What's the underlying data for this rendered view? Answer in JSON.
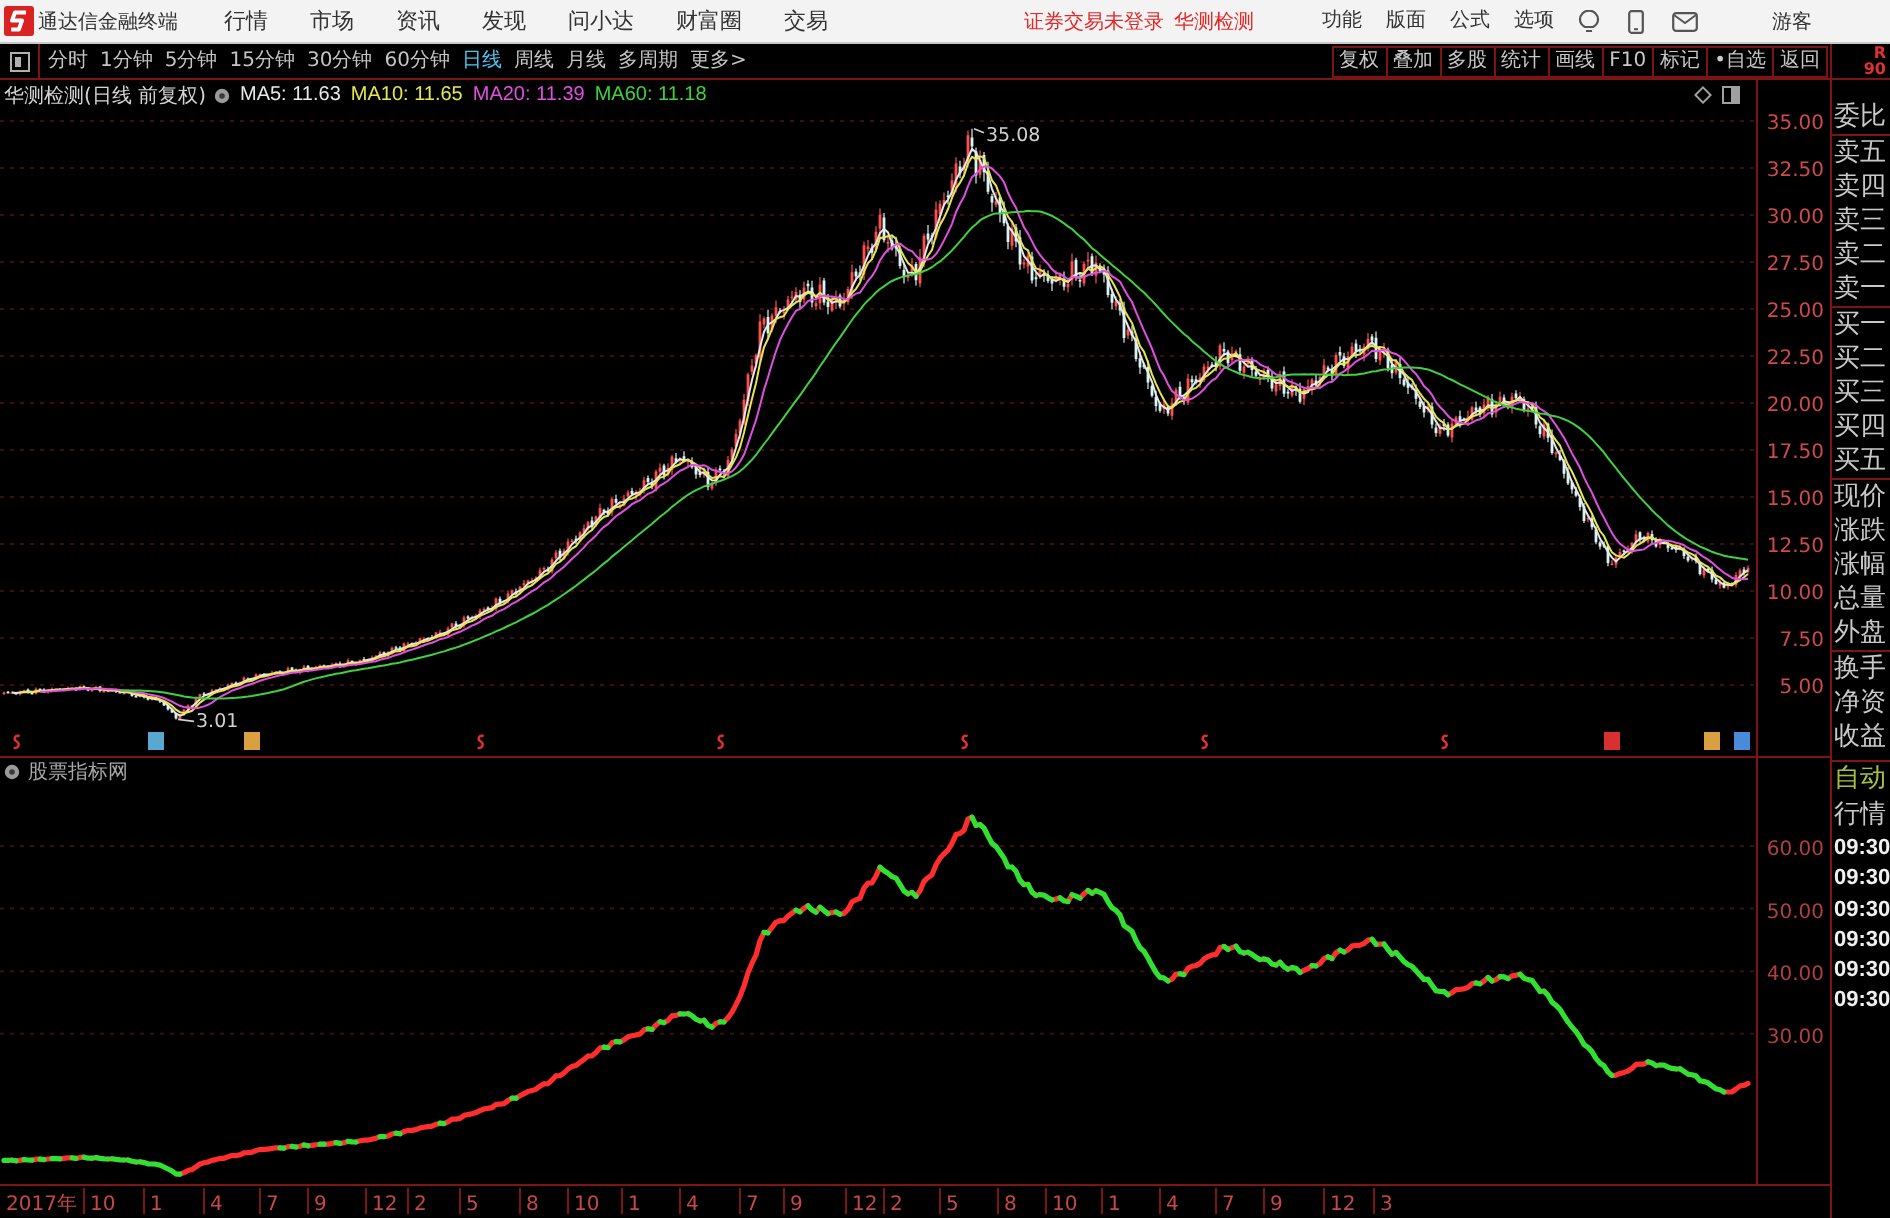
{
  "app": {
    "name": "通达信金融终端"
  },
  "menu": [
    "行情",
    "市场",
    "资讯",
    "发现",
    "问小达",
    "财富圈",
    "交易"
  ],
  "notices": [
    "证券交易未登录",
    "华测检测"
  ],
  "actions": [
    "功能",
    "版面",
    "公式",
    "选项"
  ],
  "user": "游客",
  "periods": [
    {
      "label": "分时",
      "selected": false
    },
    {
      "label": "1分钟",
      "selected": false
    },
    {
      "label": "5分钟",
      "selected": false
    },
    {
      "label": "15分钟",
      "selected": false
    },
    {
      "label": "30分钟",
      "selected": false
    },
    {
      "label": "60分钟",
      "selected": false
    },
    {
      "label": "日线",
      "selected": true
    },
    {
      "label": "周线",
      "selected": false
    },
    {
      "label": "月线",
      "selected": false
    },
    {
      "label": "多周期",
      "selected": false
    },
    {
      "label": "更多>",
      "selected": false
    }
  ],
  "tools": [
    "复权",
    "叠加",
    "多股",
    "统计",
    "画线",
    "F10",
    "标记",
    "•自选",
    "返回"
  ],
  "side_header": [
    "R",
    "90"
  ],
  "price_chart": {
    "title": "华测检测(日线 前复权)",
    "indicators": [
      {
        "label": "MA5: 11.63",
        "color": "#e8e8e8"
      },
      {
        "label": "MA10: 11.65",
        "color": "#e6e650"
      },
      {
        "label": "MA20: 11.39",
        "color": "#e050e0"
      },
      {
        "label": "MA60: 11.18",
        "color": "#40d040"
      }
    ],
    "axis_labels": [
      "35.00",
      "32.50",
      "30.00",
      "27.50",
      "25.00",
      "22.50",
      "20.00",
      "17.50",
      "15.00",
      "12.50",
      "10.00",
      "7.50",
      "5.00"
    ],
    "high_label": "35.08",
    "low_label": "3.01"
  },
  "indicator_chart": {
    "title": "股票指标网",
    "axis_labels": [
      "60.00",
      "50.00",
      "40.00",
      "30.00"
    ]
  },
  "time_axis": [
    "2017年",
    "10",
    "1",
    "4",
    "7",
    "9",
    "12",
    "2",
    "5",
    "8",
    "10",
    "1",
    "4",
    "7",
    "9",
    "12",
    "2",
    "5",
    "8",
    "10",
    "1",
    "4",
    "7",
    "9",
    "12",
    "3"
  ],
  "quote_panel": {
    "groups": [
      [
        "委比"
      ],
      [
        "卖五",
        "卖四",
        "卖三",
        "卖二",
        "卖一"
      ],
      [
        "买一",
        "买二",
        "买三",
        "买四",
        "买五"
      ],
      [
        "现价",
        "涨跌",
        "涨幅",
        "总量",
        "外盘"
      ],
      [
        "换手",
        "净资",
        "收益"
      ]
    ],
    "mode": "自动",
    "tab": "行情",
    "times": [
      "09:30",
      "09:30",
      "09:30",
      "09:30",
      "09:30",
      "09:30"
    ]
  }
}
